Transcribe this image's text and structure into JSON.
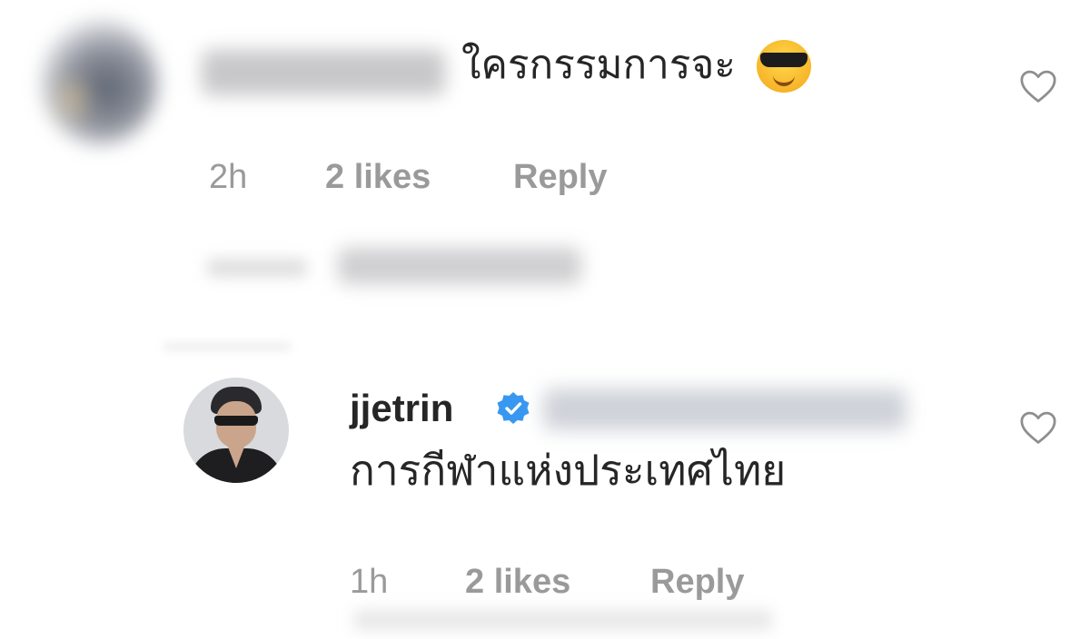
{
  "comments": [
    {
      "username": "",
      "text": "ใครกรรมการจะ",
      "emoji": "smiling-face-with-sunglasses",
      "time": "2h",
      "likes": "2 likes",
      "reply": "Reply",
      "liked": false
    },
    {
      "username": "jjetrin",
      "verified": true,
      "text": "การกีฬาแห่งประเทศไทย",
      "time": "1h",
      "likes": "2 likes",
      "reply": "Reply",
      "liked": false
    }
  ],
  "colors": {
    "text_primary": "#262626",
    "text_meta": "#9a9a9a",
    "verified_blue": "#3897f0"
  }
}
